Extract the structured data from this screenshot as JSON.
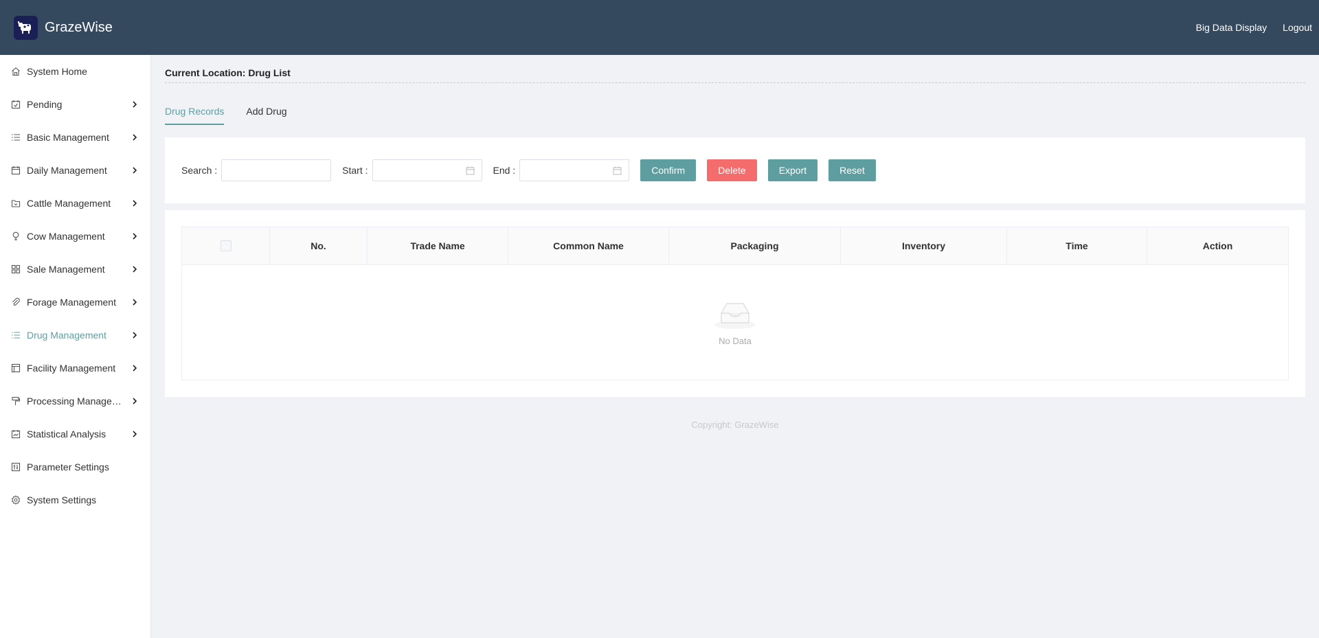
{
  "header": {
    "brand": "GrazeWise",
    "links": [
      "Big Data Display",
      "Logout"
    ]
  },
  "sidebar": {
    "items": [
      {
        "label": "System Home",
        "icon": "home-icon",
        "has_children": false
      },
      {
        "label": "Pending",
        "icon": "calendar-check-icon",
        "has_children": true
      },
      {
        "label": "Basic Management",
        "icon": "list-icon",
        "has_children": true
      },
      {
        "label": "Daily Management",
        "icon": "calendar-icon",
        "has_children": true
      },
      {
        "label": "Cattle Management",
        "icon": "folder-icon",
        "has_children": true
      },
      {
        "label": "Cow Management",
        "icon": "bulb-icon",
        "has_children": true
      },
      {
        "label": "Sale Management",
        "icon": "grid-icon",
        "has_children": true
      },
      {
        "label": "Forage Management",
        "icon": "paperclip-icon",
        "has_children": true
      },
      {
        "label": "Drug Management",
        "icon": "list-icon",
        "has_children": true,
        "active": true
      },
      {
        "label": "Facility Management",
        "icon": "layout-icon",
        "has_children": true
      },
      {
        "label": "Processing Managem...",
        "icon": "brush-icon",
        "has_children": true
      },
      {
        "label": "Statistical Analysis",
        "icon": "calendar-chart-icon",
        "has_children": true
      },
      {
        "label": "Parameter Settings",
        "icon": "sliders-icon",
        "has_children": false
      },
      {
        "label": "System Settings",
        "icon": "gear-icon",
        "has_children": false
      }
    ]
  },
  "location": "Current Location: Drug List",
  "tabs": [
    {
      "label": "Drug Records",
      "active": true
    },
    {
      "label": "Add Drug",
      "active": false
    }
  ],
  "search": {
    "search_label": "Search :",
    "start_label": "Start :",
    "end_label": "End :",
    "search_value": "",
    "start_value": "",
    "end_value": "",
    "buttons": {
      "confirm": "Confirm",
      "delete": "Delete",
      "export": "Export",
      "reset": "Reset"
    }
  },
  "table": {
    "columns": [
      "No.",
      "Trade Name",
      "Common Name",
      "Packaging",
      "Inventory",
      "Time",
      "Action"
    ],
    "rows": [],
    "empty_text": "No Data"
  },
  "footer": {
    "copyright": "Copyright: GrazeWise"
  },
  "colors": {
    "header_bg": "#34495e",
    "accent": "#5f9ea0",
    "danger": "#f56c6c"
  }
}
